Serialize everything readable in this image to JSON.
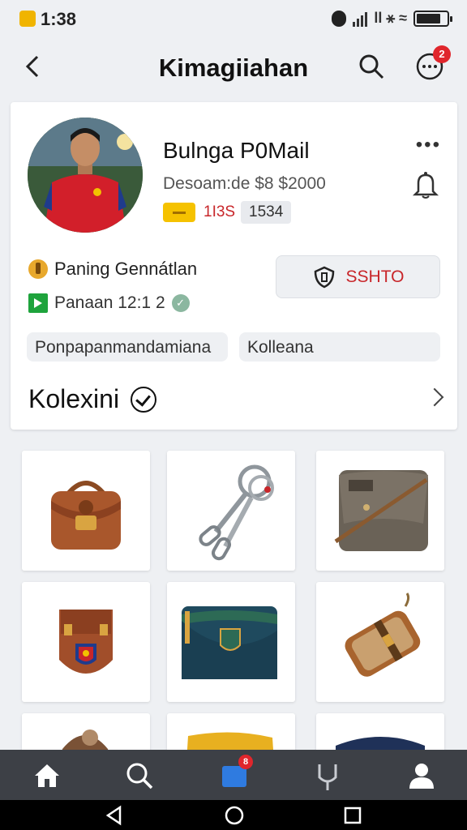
{
  "status_bar": {
    "time": "1:38"
  },
  "header": {
    "title": "Kimagiiahan",
    "notification_count": "2"
  },
  "profile": {
    "name": "Bulnga P0Mail",
    "subtitle": "Desoam:de $8 $2000",
    "stat_red": "1I3S",
    "stat_gray": "1534",
    "info_line1": "Paning Gennátlan",
    "info_line2": "Panaan 12:1 2",
    "action_label": "SSHTO",
    "tags": [
      "Ponpapanmandamiana",
      "Kolleana"
    ]
  },
  "collection": {
    "title": "Kolexini"
  },
  "items": [
    {
      "name": "brown-leather-satchel"
    },
    {
      "name": "metal-keychain-clips"
    },
    {
      "name": "grey-messenger-bag"
    },
    {
      "name": "leather-crest-pouch"
    },
    {
      "name": "navy-club-wallet"
    },
    {
      "name": "tan-leather-strap-bag"
    },
    {
      "name": "brown-bag-partial"
    },
    {
      "name": "yellow-item-partial"
    },
    {
      "name": "navy-item-partial"
    }
  ],
  "bottom_nav": {
    "items": [
      "home-icon",
      "search-icon",
      "messages-icon",
      "activity-icon",
      "profile-icon"
    ],
    "messages_badge": "8"
  },
  "colors": {
    "accent_red": "#c8262a",
    "badge_red": "#e0262c",
    "chip_yellow": "#f5c200",
    "nav_bg": "#3d4046"
  }
}
